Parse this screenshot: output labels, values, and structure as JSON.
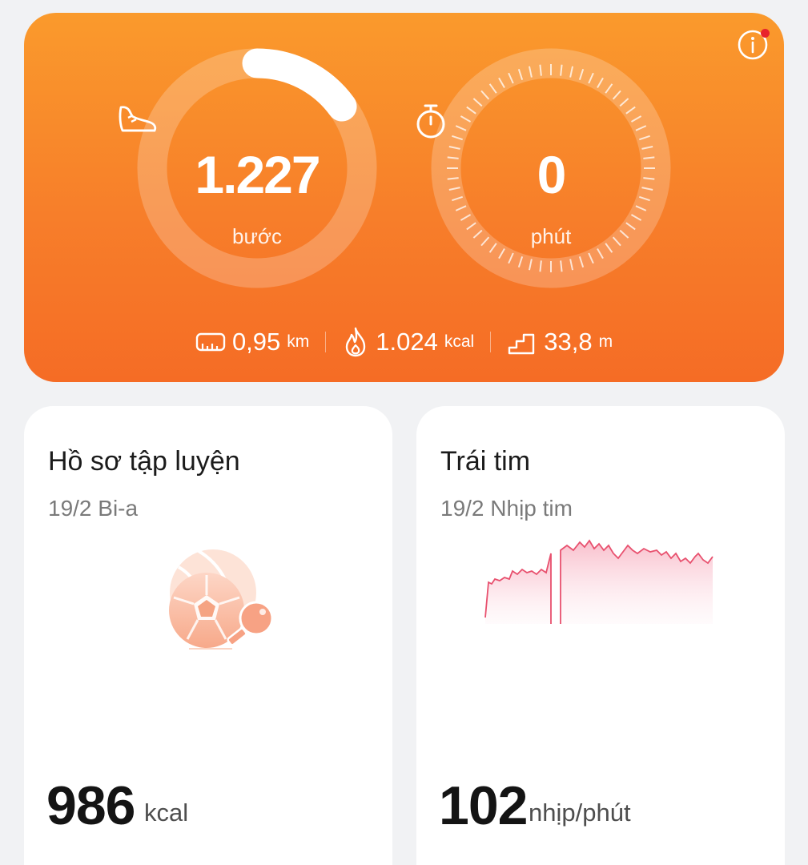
{
  "activity": {
    "steps": {
      "value": "1.227",
      "unit": "bước",
      "progress": 0.15
    },
    "minutes": {
      "value": "0",
      "unit": "phút"
    },
    "distance": {
      "value": "0,95",
      "unit": "km"
    },
    "calories": {
      "value": "1.024",
      "unit": "kcal"
    },
    "climb": {
      "value": "33,8",
      "unit": "m"
    }
  },
  "workout_card": {
    "title": "Hồ sơ tập luyện",
    "subtitle": "19/2 Bi-a",
    "value": "986",
    "unit": "kcal"
  },
  "heart_card": {
    "title": "Trái tim",
    "subtitle": "19/2 Nhịp tim",
    "value": "102",
    "unit": "nhịp/phút"
  },
  "colors": {
    "accent_orange": "#f77e2a",
    "heart_line": "#e8506e",
    "notification_dot": "#e8232b"
  },
  "icons": [
    "info-icon",
    "shoe-icon",
    "stopwatch-icon",
    "ruler-icon",
    "flame-icon",
    "stairs-icon",
    "sports-balls-icon"
  ]
}
